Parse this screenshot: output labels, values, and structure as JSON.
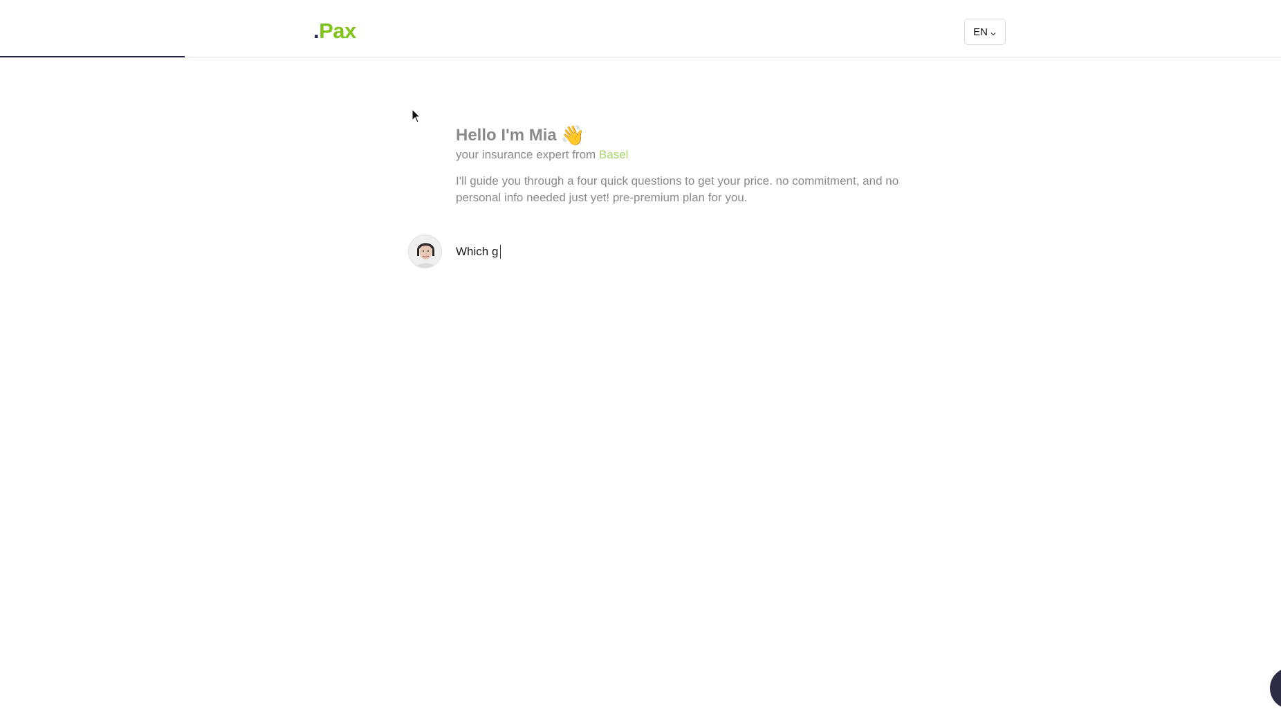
{
  "header": {
    "logo_dot": ".",
    "logo_text": "Pax",
    "language": "EN",
    "progress": 0.144
  },
  "intro": {
    "greeting": "Hello I'm Mia",
    "greeting_emoji": "👋",
    "subtitle_prefix": "your insurance expert from ",
    "city": "Basel",
    "description": "I'll guide you through a four quick questions to get your price. no commitment, and no personal info needed just yet! pre-premium plan for you."
  },
  "chat": {
    "typing_text": "Which g"
  },
  "colors": {
    "brand_green": "#7fc31c",
    "brand_navy": "#24244a",
    "muted_text": "#8a8a8a",
    "city_green": "#a8d46a"
  },
  "icons": {
    "language_chevron": "chevron-down-icon",
    "chat_launcher": "chat-icon"
  }
}
